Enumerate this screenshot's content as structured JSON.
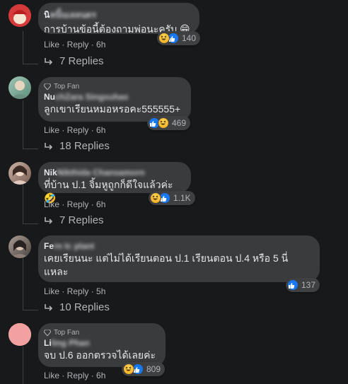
{
  "comments": [
    {
      "name_visible": "นิ",
      "name_blurred": "คนิ้นเลลนดร",
      "top_fan": false,
      "text": "การบ้านข้อนี้ต้องถามพ่อนะครับ 😁",
      "reactions": [
        "haha",
        "like"
      ],
      "count": "140",
      "actions": "Like · Reply · 6h",
      "replies": "7 Replies"
    },
    {
      "name_visible": "Nu",
      "name_blurred": "chZara Singsuhas",
      "top_fan": true,
      "text": "ลูกเขาเรียนหมอหรอคะ555555+",
      "reactions": [
        "like",
        "haha"
      ],
      "count": "469",
      "actions": "Like · Reply · 6h",
      "replies": "18 Replies"
    },
    {
      "name_visible": "Nik",
      "name_blurred": "Nikthida Chansamorn",
      "top_fan": false,
      "text": "ที่บ้าน ป.1 จิ้มหูถูกก็ดีใจแล้วค่ะ🤣",
      "reactions": [
        "haha",
        "like"
      ],
      "count": "1.1K",
      "actions": "Like · Reply · 6h",
      "replies": "7 Replies"
    },
    {
      "name_visible": "Fe",
      "name_blurred": "rn Ic plant",
      "top_fan": false,
      "text": "เคยเรียนนะ แต่ไม่ได้เรียนตอน ป.1 เรียนตอน ป.4 หรือ 5 นี่แหละ",
      "reactions": [
        "like"
      ],
      "count": "137",
      "actions": "Like · Reply · 5h",
      "replies": "10 Replies"
    },
    {
      "name_visible": "Li",
      "name_blurred": "ling Phan",
      "top_fan": true,
      "text": "จบ ป.6 ออกตรวจได้เลยค่ะ",
      "reactions": [
        "haha",
        "like"
      ],
      "count": "809",
      "actions": "Like · Reply · 6h",
      "replies": ""
    }
  ],
  "top_fan_label": "Top Fan",
  "colors": {
    "background": "#18191a",
    "bubble": "#3a3b3c",
    "text_primary": "#e4e6eb",
    "text_secondary": "#b0b3b8",
    "like_blue": "#1877f2"
  }
}
